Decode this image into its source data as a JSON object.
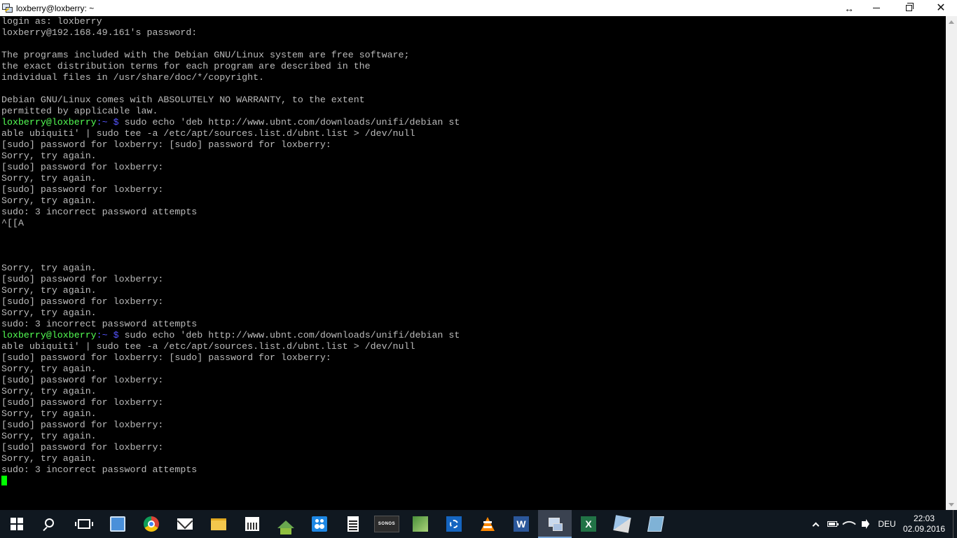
{
  "window": {
    "title": "loxberry@loxberry: ~"
  },
  "terminal": {
    "lines": [
      {
        "text": "login as: loxberry"
      },
      {
        "text": "loxberry@192.168.49.161's password:"
      },
      {
        "text": ""
      },
      {
        "text": "The programs included with the Debian GNU/Linux system are free software;"
      },
      {
        "text": "the exact distribution terms for each program are described in the"
      },
      {
        "text": "individual files in /usr/share/doc/*/copyright."
      },
      {
        "text": ""
      },
      {
        "text": "Debian GNU/Linux comes with ABSOLUTELY NO WARRANTY, to the extent"
      },
      {
        "text": "permitted by applicable law."
      },
      {
        "prompt": "loxberry@loxberry",
        "dir": "~",
        "symbol": "$",
        "text": " sudo echo 'deb http://www.ubnt.com/downloads/unifi/debian st"
      },
      {
        "text": "able ubiquiti' | sudo tee -a /etc/apt/sources.list.d/ubnt.list > /dev/null"
      },
      {
        "text": "[sudo] password for loxberry: [sudo] password for loxberry:"
      },
      {
        "text": "Sorry, try again."
      },
      {
        "text": "[sudo] password for loxberry:"
      },
      {
        "text": "Sorry, try again."
      },
      {
        "text": "[sudo] password for loxberry:"
      },
      {
        "text": "Sorry, try again."
      },
      {
        "text": "sudo: 3 incorrect password attempts"
      },
      {
        "text": "^[[A"
      },
      {
        "text": ""
      },
      {
        "text": ""
      },
      {
        "text": ""
      },
      {
        "text": "Sorry, try again."
      },
      {
        "text": "[sudo] password for loxberry:"
      },
      {
        "text": "Sorry, try again."
      },
      {
        "text": "[sudo] password for loxberry:"
      },
      {
        "text": "Sorry, try again."
      },
      {
        "text": "sudo: 3 incorrect password attempts"
      },
      {
        "prompt": "loxberry@loxberry",
        "dir": "~",
        "symbol": "$",
        "text": " sudo echo 'deb http://www.ubnt.com/downloads/unifi/debian st"
      },
      {
        "text": "able ubiquiti' | sudo tee -a /etc/apt/sources.list.d/ubnt.list > /dev/null"
      },
      {
        "text": "[sudo] password for loxberry: [sudo] password for loxberry:"
      },
      {
        "text": "Sorry, try again."
      },
      {
        "text": "[sudo] password for loxberry:"
      },
      {
        "text": "Sorry, try again."
      },
      {
        "text": "[sudo] password for loxberry:"
      },
      {
        "text": "Sorry, try again."
      },
      {
        "text": "[sudo] password for loxberry:"
      },
      {
        "text": "Sorry, try again."
      },
      {
        "text": "[sudo] password for loxberry:"
      },
      {
        "text": "Sorry, try again."
      },
      {
        "text": "sudo: 3 incorrect password attempts"
      }
    ]
  },
  "colors": {
    "background": "#000000",
    "text": "#bbbbbb",
    "prompt": "#54ff54",
    "dir": "#5555ff",
    "cursor": "#00ff00"
  },
  "taskbar": {
    "apps": [
      {
        "name": "start-button",
        "icon": "windows-start-icon"
      },
      {
        "name": "search-button",
        "icon": "search-icon"
      },
      {
        "name": "task-view-button",
        "icon": "task-view-icon"
      },
      {
        "name": "taskbar-app-contacts",
        "icon": "contact-card-icon"
      },
      {
        "name": "taskbar-app-chrome",
        "icon": "chrome-icon"
      },
      {
        "name": "taskbar-app-mail",
        "icon": "mail-icon"
      },
      {
        "name": "taskbar-app-explorer",
        "icon": "folder-icon"
      },
      {
        "name": "taskbar-app-calendar",
        "icon": "calendar-icon"
      },
      {
        "name": "taskbar-app-home",
        "icon": "house-icon"
      },
      {
        "name": "taskbar-app-people",
        "icon": "people-icon"
      },
      {
        "name": "taskbar-app-calculator",
        "icon": "calculator-icon"
      },
      {
        "name": "taskbar-app-sonos",
        "icon": "sonos-icon",
        "label": "SONOS"
      },
      {
        "name": "taskbar-app-maps",
        "icon": "map-icon"
      },
      {
        "name": "taskbar-app-settings",
        "icon": "gear-icon"
      },
      {
        "name": "taskbar-app-vlc",
        "icon": "vlc-cone-icon"
      },
      {
        "name": "taskbar-app-word",
        "icon": "word-icon",
        "label": "W"
      },
      {
        "name": "taskbar-app-putty",
        "icon": "putty-icon",
        "active": true
      },
      {
        "name": "taskbar-app-excel",
        "icon": "excel-icon",
        "label": "X"
      },
      {
        "name": "taskbar-app-tools",
        "icon": "tools-icon"
      },
      {
        "name": "taskbar-app-notes",
        "icon": "notes-icon"
      }
    ],
    "tray": {
      "language": "DEU",
      "time": "22:03",
      "date": "02.09.2016"
    }
  }
}
